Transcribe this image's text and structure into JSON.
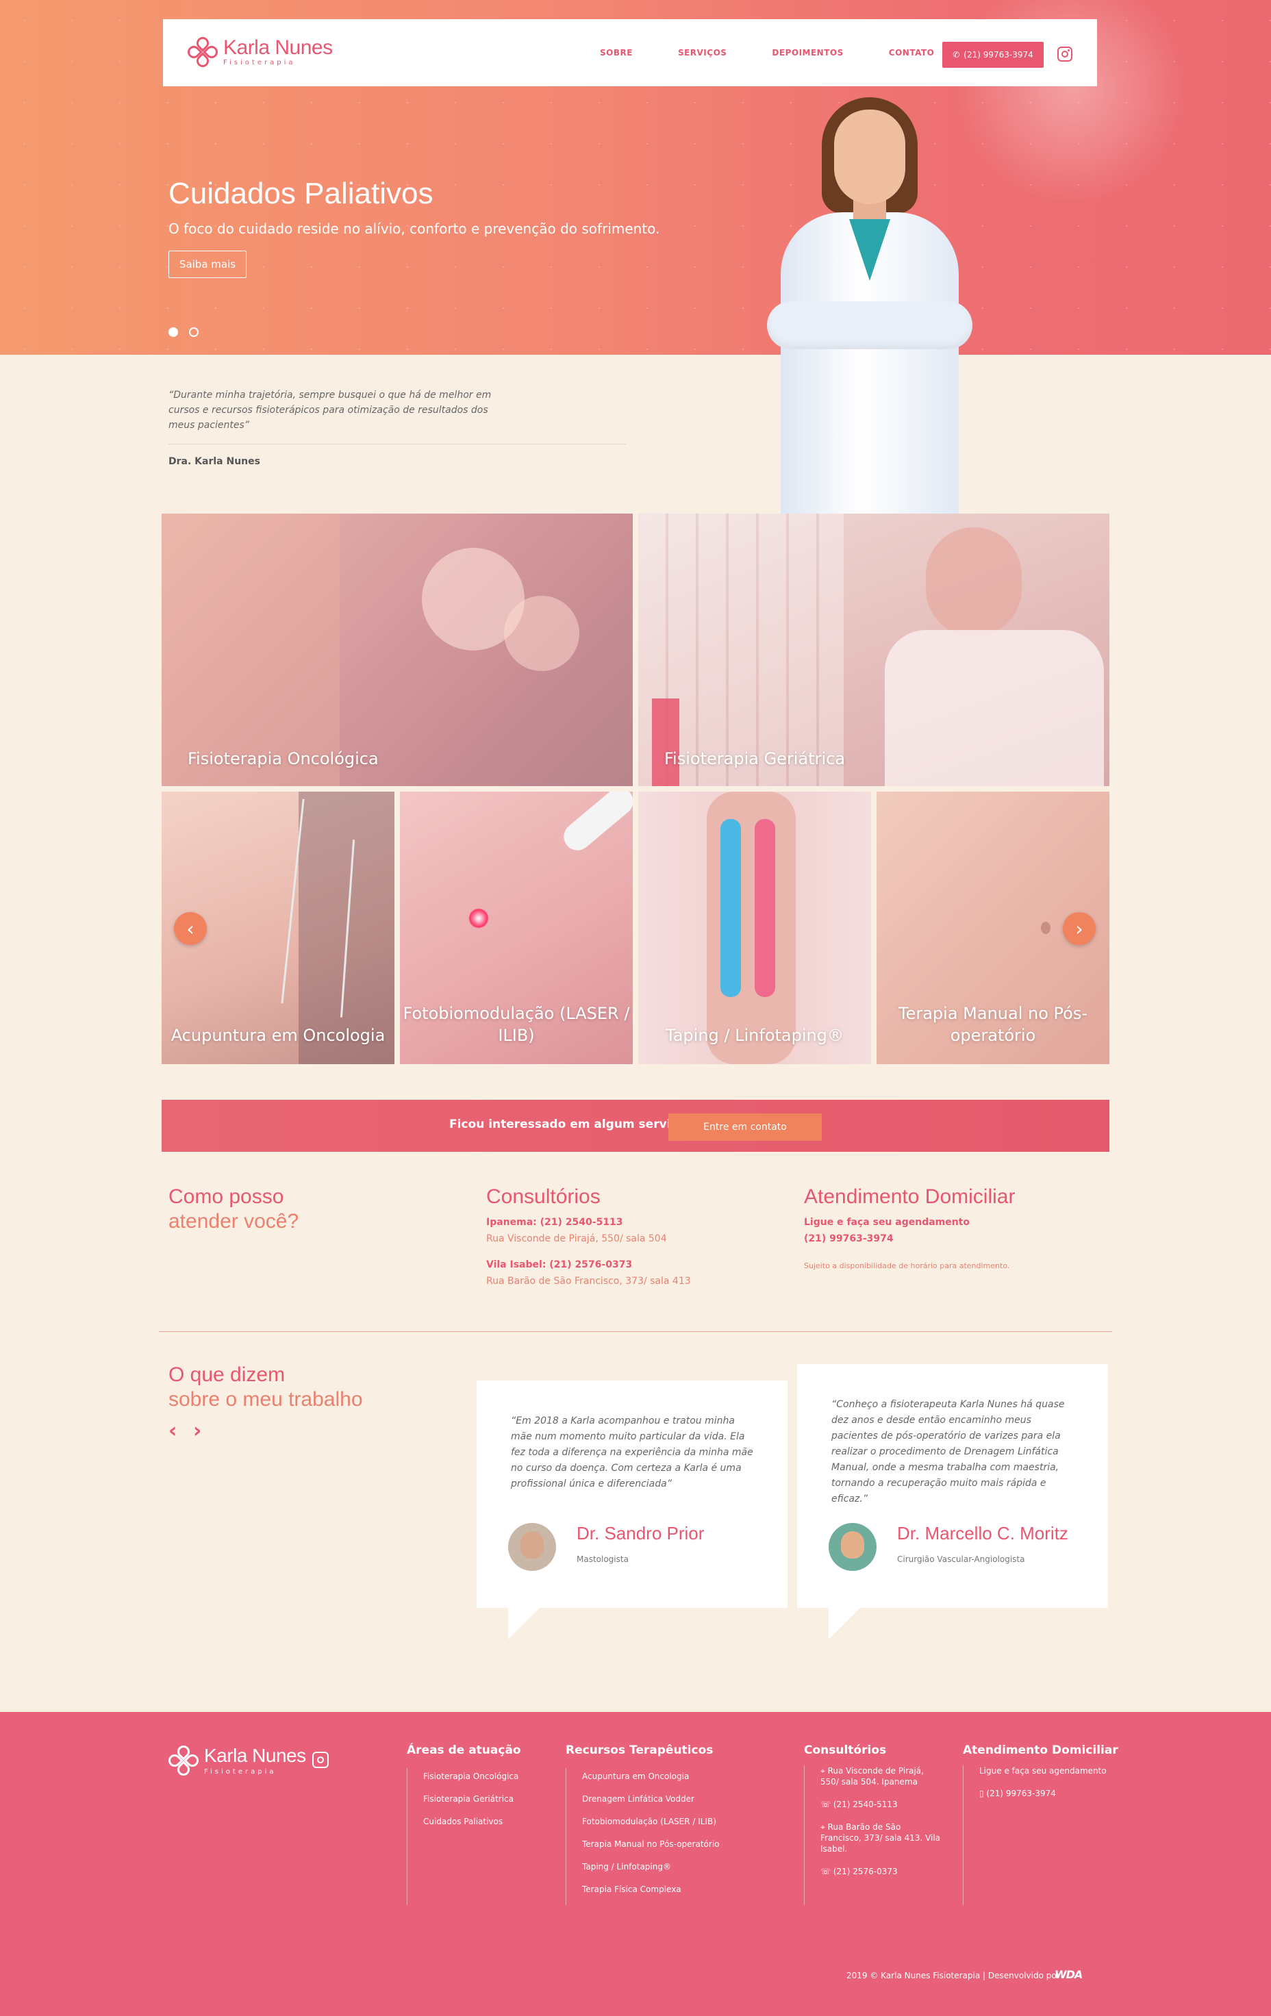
{
  "brand": {
    "name": "Karla Nunes",
    "tagline": "Fisioterapia",
    "color": "#e8566f",
    "accent": "#f0825e"
  },
  "nav": {
    "items": [
      "SOBRE",
      "SERVIÇOS",
      "DEPOIMENTOS",
      "CONTATO"
    ],
    "phone": "(21) 99763-3974"
  },
  "hero": {
    "title": "Cuidados Paliativos",
    "subtitle": "O foco do cuidado reside no alívio, conforto e prevenção do sofrimento.",
    "button": "Saiba mais",
    "slides": 2,
    "active_slide": 1
  },
  "quote": {
    "text": "“Durante minha trajetória, sempre busquei o que há de melhor em cursos e recursos fisioterápicos para otimização de resultados dos meus pacientes”",
    "author": "Dra. Karla Nunes"
  },
  "services": {
    "big": [
      "Fisioterapia Oncológica",
      "Fisioterapia Geriátrica"
    ],
    "small": [
      "Acupuntura em Oncologia",
      "Fotobiomodulação (LASER / ILIB)",
      "Taping / Linfotaping®",
      "Terapia Manual no Pós-operatório"
    ],
    "prev_icon": "chevron-left-icon",
    "next_icon": "chevron-right-icon"
  },
  "cta": {
    "text": "Ficou interessado em algum serviço?",
    "button": "Entre em contato"
  },
  "info": {
    "help": {
      "line1": "Como posso",
      "line2": "atender você?"
    },
    "offices": {
      "title": "Consultórios",
      "ipanema_phone": "Ipanema: (21) 2540-5113",
      "ipanema_addr": "Rua Visconde de Pirajá, 550/ sala 504",
      "vila_phone": "Vila Isabel: (21) 2576-0373",
      "vila_addr": "Rua Barão de São Francisco, 373/ sala 413"
    },
    "home": {
      "title": "Atendimento Domiciliar",
      "line1": "Ligue e faça seu agendamento",
      "phone": "(21) 99763-3974",
      "note": "Sujeito a disponibilidade de horário para atendimento."
    }
  },
  "testimonials": {
    "title1": "O que dizem",
    "title2": "sobre o meu trabalho",
    "items": [
      {
        "text": "“Em 2018 a Karla acompanhou e tratou minha mãe num momento muito particular da vida. Ela fez toda a diferença na experiência da minha mãe no curso da doença. Com certeza a Karla é uma profissional única e diferenciada”",
        "name": "Dr. Sandro Prior",
        "role": "Mastologista"
      },
      {
        "text": "“Conheço a fisioterapeuta Karla Nunes há quase dez anos e desde então encaminho meus pacientes de pós-operatório de varizes para ela realizar o procedimento de Drenagem Linfática Manual, onde a mesma trabalha com maestria, tornando a recuperação muito mais rápida e eficaz.”",
        "name": "Dr. Marcello C. Moritz",
        "role": "Cirurgião Vascular-Angiologista"
      }
    ]
  },
  "footer": {
    "areas": {
      "title": "Áreas de atuação",
      "items": [
        "Fisioterapia Oncológica",
        "Fisioterapia Geriátrica",
        "Cuidados Paliativos"
      ]
    },
    "resources": {
      "title": "Recursos Terapêuticos",
      "items": [
        "Acupuntura em Oncologia",
        "Drenagem Linfática Vodder",
        "Fotobiomodulação (LASER / ILIB)",
        "Terapia Manual no Pós-operatório",
        "Taping / Linfotaping®",
        "Terapia Física Complexa"
      ]
    },
    "offices": {
      "title": "Consultórios",
      "items": [
        "Rua Visconde de Pirajá, 550/ sala 504. Ipanema",
        "(21) 2540-5113",
        "Rua Barão de São Francisco, 373/ sala 413. Vila Isabel.",
        "(21) 2576-0373"
      ]
    },
    "home": {
      "title": "Atendimento Domiciliar",
      "items": [
        "Ligue e faça seu agendamento",
        "(21) 99763-3974"
      ]
    },
    "copyright": "2019 © Karla Nunes Fisioterapia | Desenvolvido por",
    "dev": "WDA"
  }
}
